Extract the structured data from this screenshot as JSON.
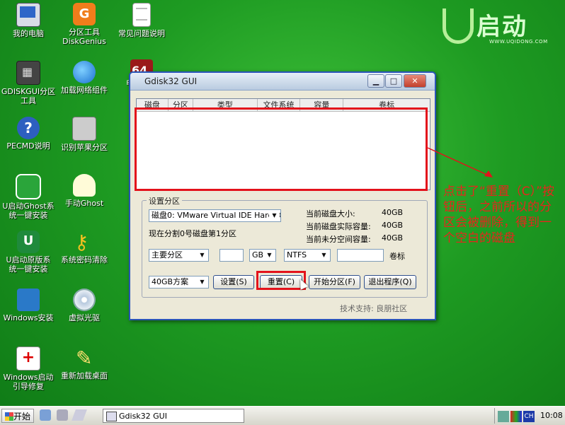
{
  "desktop": {
    "icons": [
      {
        "label": "我的电脑",
        "icon": "computer-icon"
      },
      {
        "label": "分区工具\nDiskGenius",
        "icon": "diskgenius-icon"
      },
      {
        "label": "常见问题说明",
        "icon": "document-icon"
      },
      {
        "label": "GDISKGUI分区\n工具",
        "icon": "gdiskgui-icon"
      },
      {
        "label": "加载网络组件",
        "icon": "network-globe-icon"
      },
      {
        "label": "PECMD说明",
        "icon": "help-icon"
      },
      {
        "label": "识别苹果分区",
        "icon": "mac-disk-icon"
      },
      {
        "label": "U启动Ghost系\n统一键安装",
        "icon": "ghost-install-icon"
      },
      {
        "label": "手动Ghost",
        "icon": "ghost-icon"
      },
      {
        "label": "U启动原版系\n统一键安装",
        "icon": "uqidong-icon"
      },
      {
        "label": "系统密码清除",
        "icon": "key-icon"
      },
      {
        "label": "Windows安装",
        "icon": "windows-install-icon"
      },
      {
        "label": "虚拟光驱",
        "icon": "cdrom-icon"
      },
      {
        "label": "Windows启动\n引导修复",
        "icon": "first-aid-icon"
      },
      {
        "label": "重新加载桌面",
        "icon": "reload-desktop-icon"
      },
      {
        "label": "",
        "icon": "x64-icon"
      }
    ],
    "partial_label": "电脑检测",
    "logo": {
      "text": "启动",
      "url": "WWW.UQIDONG.COM"
    }
  },
  "window": {
    "title": "Gdisk32 GUI",
    "table_headers": [
      "磁盘",
      "分区",
      "类型",
      "文件系统",
      "容量",
      "卷标"
    ],
    "group_title": "设置分区",
    "disk_select": "磁盘0: VMware Virtual IDE Hard Di",
    "current_status": "现在分割0号磁盘第1分区",
    "stats": [
      {
        "label": "当前磁盘大小:",
        "value": "40GB"
      },
      {
        "label": "当前磁盘实际容量:",
        "value": "40GB"
      },
      {
        "label": "当前未分空间容量:",
        "value": "40GB"
      }
    ],
    "partition_type": "主要分区",
    "size_value": "",
    "unit": "GB",
    "filesystem": "NTFS",
    "volume_label_value": "",
    "volume_label_caption": "卷标",
    "scheme": "40GB方案",
    "buttons": {
      "setup": "设置(S)",
      "reset": "重置(C)",
      "start": "开始分区(F)",
      "exit": "退出程序(Q)"
    },
    "footer": "技术支持: 良朋社区"
  },
  "annotation": {
    "text": "点击了“重置（C）”按钮后，之前所以的分区会被删除，得到一个空白的磁盘",
    "color": "#e7251c"
  },
  "taskbar": {
    "start_label": "开始",
    "task_title": "Gdisk32 GUI",
    "lang": "CH",
    "clock": "10:08"
  }
}
